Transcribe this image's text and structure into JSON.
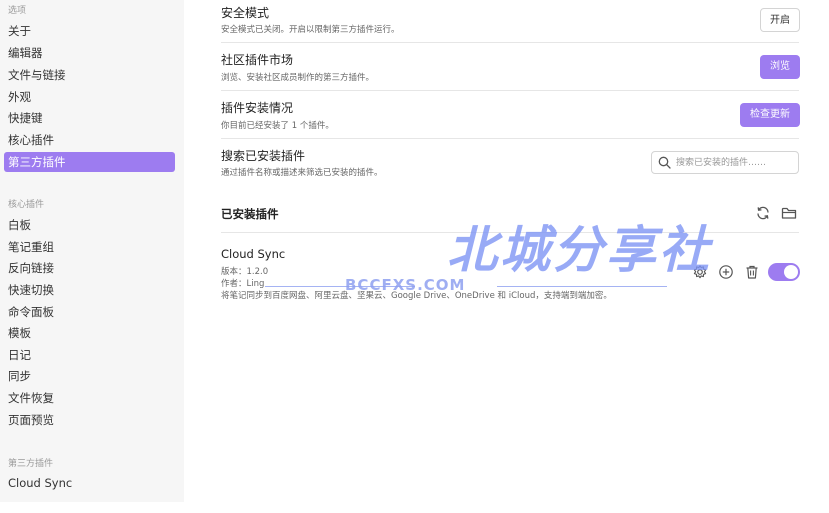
{
  "sidebar": {
    "options_heading": "选项",
    "options": [
      "关于",
      "编辑器",
      "文件与链接",
      "外观",
      "快捷键",
      "核心插件",
      "第三方插件"
    ],
    "active_label": "第三方插件",
    "core_heading": "核心插件",
    "core_items": [
      "白板",
      "笔记重组",
      "反向链接",
      "快速切换",
      "命令面板",
      "模板",
      "日记",
      "同步",
      "文件恢复",
      "页面预览"
    ],
    "community_heading": "第三方插件",
    "community_items": [
      "Cloud Sync"
    ]
  },
  "main": {
    "safe_mode": {
      "title": "安全模式",
      "desc": "安全模式已关闭。开启以限制第三方插件运行。",
      "button": "开启"
    },
    "market": {
      "title": "社区插件市场",
      "desc": "浏览、安装社区成员制作的第三方插件。",
      "button": "浏览"
    },
    "install_status": {
      "title": "插件安装情况",
      "desc": "你目前已经安装了 1 个插件。",
      "button": "检查更新"
    },
    "search_installed": {
      "title": "搜索已安装插件",
      "desc": "通过插件名称或描述来筛选已安装的插件。",
      "placeholder": "搜索已安装的插件……",
      "value": ""
    },
    "installed_heading": "已安装插件",
    "plugin": {
      "name": "Cloud Sync",
      "version": "版本：1.2.0",
      "author": "作者：Ling",
      "desc": "将笔记同步到百度网盘、阿里云盘、坚果云、Google Drive、OneDrive 和 iCloud，支持端到端加密。",
      "enabled": true
    }
  },
  "watermark": {
    "text": "北城分享社",
    "sub": "BCCFXS.COM"
  },
  "colors": {
    "accent": "#9d7cf0",
    "sidebar_bg": "#f6f6f6",
    "divider": "#e6e6e6"
  },
  "icons": [
    "search-icon",
    "reload-icon",
    "folder-icon",
    "gear-icon",
    "plus-circle-icon",
    "trash-icon"
  ]
}
